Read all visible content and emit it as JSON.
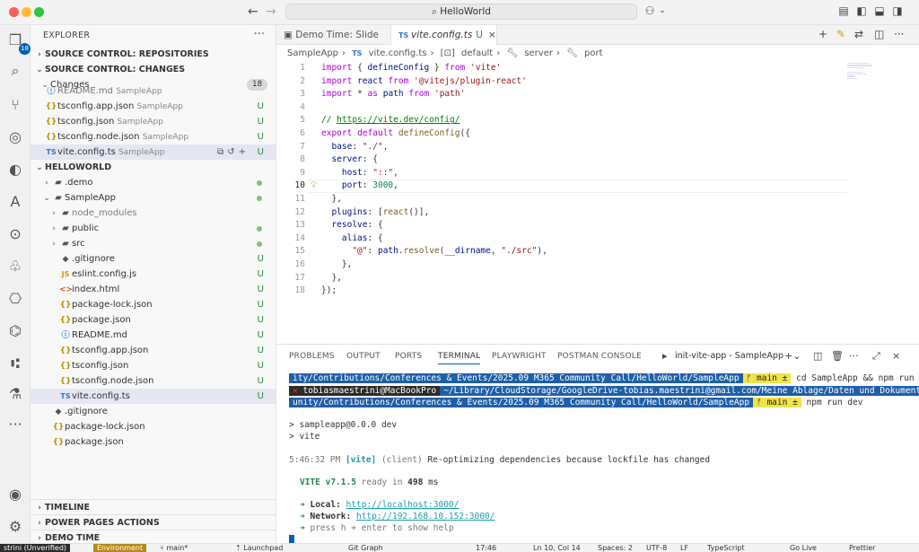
{
  "window": {
    "title": "HelloWorld"
  },
  "activitybar": {
    "badge": "18"
  },
  "sidebar": {
    "header": "EXPLORER",
    "sections": {
      "repositories": "SOURCE CONTROL: REPOSITORIES",
      "changes": "SOURCE CONTROL: CHANGES",
      "changes_group": "Changes",
      "changes_count": "18",
      "helloworld": "HELLOWORLD",
      "timeline": "TIMELINE",
      "power_pages": "POWER PAGES ACTIONS",
      "demo_time": "DEMO TIME"
    },
    "changes": [
      {
        "name": "README.md",
        "folder": "SampleApp",
        "status": ""
      },
      {
        "name": "tsconfig.app.json",
        "folder": "SampleApp",
        "status": "U"
      },
      {
        "name": "tsconfig.json",
        "folder": "SampleApp",
        "status": "U"
      },
      {
        "name": "tsconfig.node.json",
        "folder": "SampleApp",
        "status": "U"
      },
      {
        "name": "vite.config.ts",
        "folder": "SampleApp",
        "status": "U"
      }
    ],
    "tree": [
      {
        "name": ".demo"
      },
      {
        "name": "SampleApp"
      },
      {
        "name": "node_modules"
      },
      {
        "name": "public"
      },
      {
        "name": "src"
      },
      {
        "name": ".gitignore",
        "status": "U"
      },
      {
        "name": "eslint.config.js",
        "status": "U"
      },
      {
        "name": "index.html",
        "status": "U"
      },
      {
        "name": "package-lock.json",
        "status": "U"
      },
      {
        "name": "package.json",
        "status": "U"
      },
      {
        "name": "README.md",
        "status": "U"
      },
      {
        "name": "tsconfig.app.json",
        "status": "U"
      },
      {
        "name": "tsconfig.json",
        "status": "U"
      },
      {
        "name": "tsconfig.node.json",
        "status": "U"
      },
      {
        "name": "vite.config.ts",
        "status": "U"
      },
      {
        "name": ".gitignore"
      },
      {
        "name": "package-lock.json"
      },
      {
        "name": "package.json"
      }
    ]
  },
  "editor": {
    "tabs": [
      {
        "label": "Demo Time: Slide"
      },
      {
        "label": "vite.config.ts",
        "status": "U"
      }
    ],
    "breadcrumb": [
      "SampleApp",
      "vite.config.ts",
      "default",
      "server",
      "port"
    ],
    "code": [
      "import { defineConfig } from 'vite'",
      "import react from '@vitejs/plugin-react'",
      "import * as path from 'path'",
      "",
      "// https://vite.dev/config/",
      "export default defineConfig({",
      "  base: \"./\",",
      "  server: {",
      "    host: \"::\",",
      "    port: 3000,",
      "  },",
      "  plugins: [react()],",
      "  resolve: {",
      "    alias: {",
      "      \"@\": path.resolve(__dirname, \"./src\"),",
      "    },",
      "  },",
      "});"
    ]
  },
  "panel": {
    "tabs": [
      "PROBLEMS",
      "OUTPUT",
      "PORTS",
      "TERMINAL",
      "PLAYWRIGHT",
      "POSTMAN CONSOLE"
    ],
    "active_tab": "TERMINAL",
    "terminal_name": "init-vite-app - SampleApp",
    "lines": {
      "l1_path": "ity/Contributions/Conferences & Events/2025.09 M365 Community Call/HelloWorld/SampleApp",
      "l1_branch": "ᚠ main ±",
      "l1_cmd": "cd SampleApp && npm run dev",
      "l2_x": "✕",
      "l2_user": "tobiasmaestrini@MacBookPro",
      "l2_path": "~/Library/CloudStorage/GoogleDrive-tobias.maestrini@gmail.com/Meine Ablage/Daten und Dokumente/6 Co",
      "l3_path": "unity/Contributions/Conferences & Events/2025.09 M365 Community Call/HelloWorld/SampleApp",
      "l3_branch": "ᚠ main ±",
      "l3_cmd": "npm run dev",
      "l4": "> sampleapp@0.0.0 dev",
      "l5": "> vite",
      "l6_time": "5:46:32 PM",
      "l6_tag": "[vite]",
      "l6_client": "(client)",
      "l6_msg": "Re-optimizing dependencies because lockfile has changed",
      "l7_name": "VITE v7.1.5",
      "l7_ready": "ready in",
      "l7_ms": "498",
      "l7_unit": "ms",
      "l8_label": "Local:",
      "l8_url": "http://localhost:3000/",
      "l9_label": "Network:",
      "l9_url": "http://192.168.10.152:3000/",
      "l10": "press h + enter to show help"
    }
  },
  "statusbar": {
    "remote": "strini (Unverified)",
    "environment": "Environment",
    "branch": "main*",
    "launchpad": "Launchpad",
    "git_graph": "Git Graph",
    "time": "17:46",
    "position": "Ln 10, Col 14",
    "spaces": "Spaces: 2",
    "encoding": "UTF-8",
    "eol": "LF",
    "language": "TypeScript",
    "golive": "Go Live",
    "prettier": "Prettier"
  },
  "colors": {
    "accent": "#005fb8",
    "untracked": "#2b8a3e",
    "term_path_bg": "#1f5fa8",
    "term_branch_bg": "#f0e44a"
  }
}
